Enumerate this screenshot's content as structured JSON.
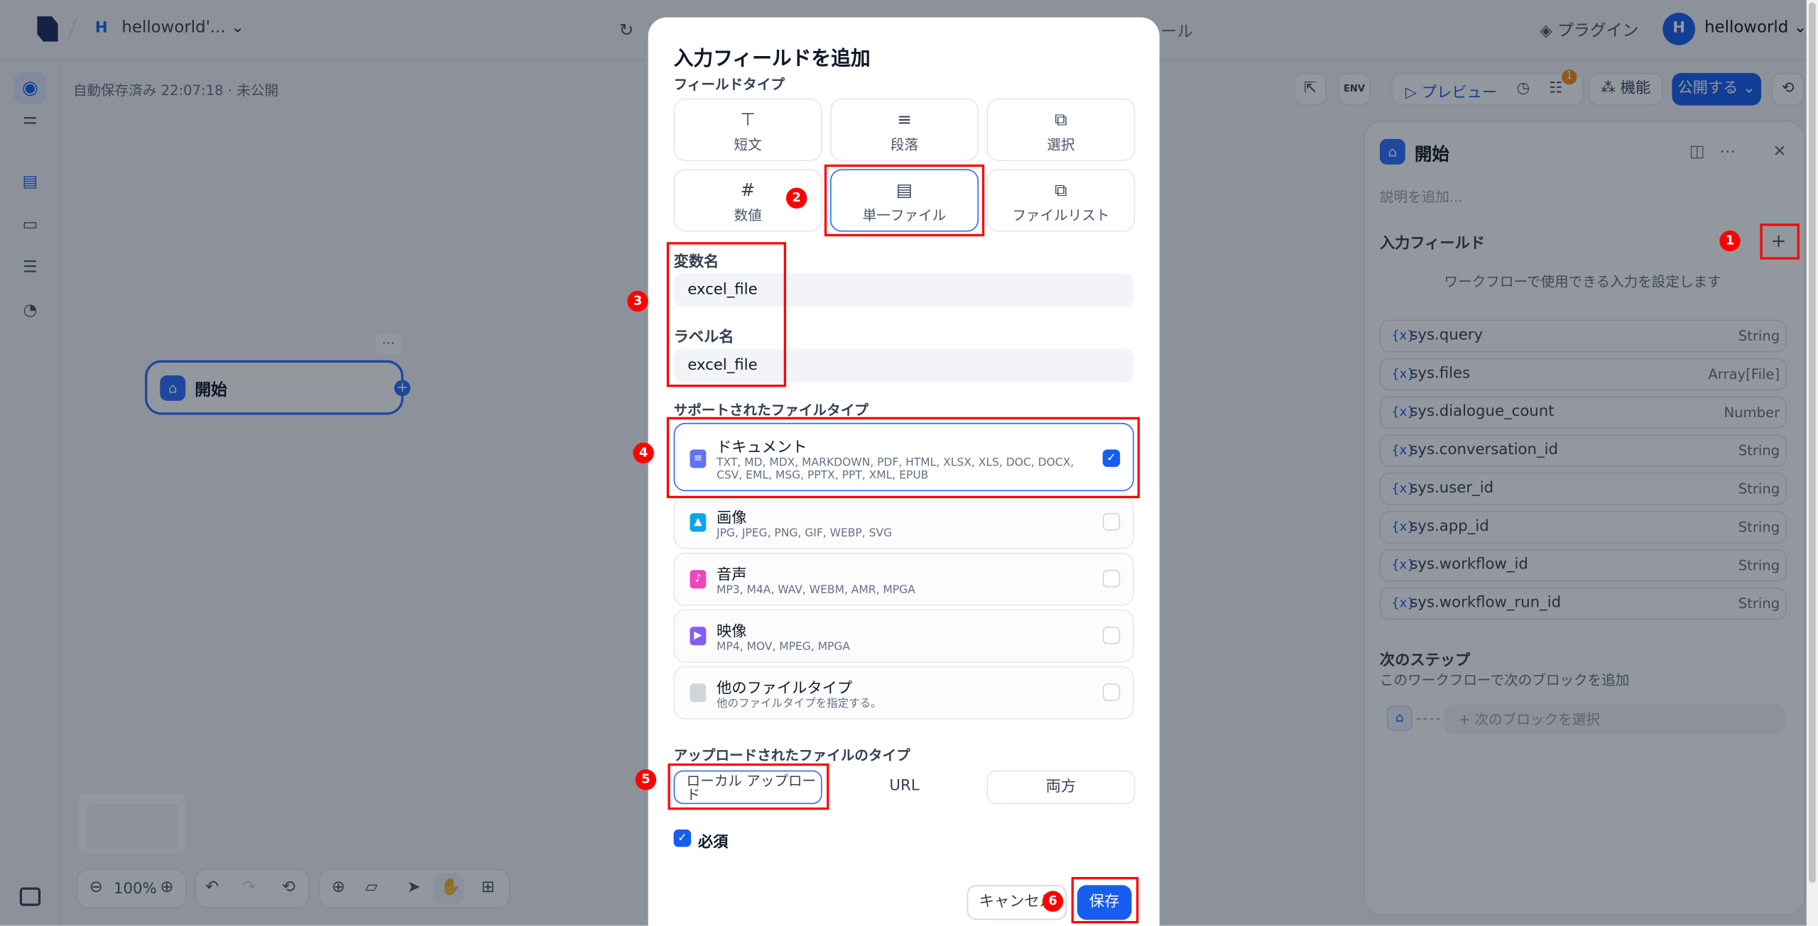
{
  "topbar": {
    "app_badge": "H",
    "app_name": "helloworld'...",
    "partial_title_tail": "ール",
    "plugins_label": "プラグイン",
    "user_initial": "H",
    "username": "helloworld"
  },
  "canvas": {
    "autosave_status": "自動保存済み 22:07:18 · 未公開",
    "node_title": "開始",
    "zoom_level": "100%"
  },
  "toolbar": {
    "preview_label": "プレビュー",
    "features_label": "機能",
    "publish_label": "公開する",
    "checklist_badge": "1",
    "env_label": "ENV"
  },
  "panel": {
    "title": "開始",
    "description_placeholder": "説明を追加...",
    "input_fields_heading": "入力フィールド",
    "input_fields_hint": "ワークフローで使用できる入力を設定します",
    "variables": [
      {
        "name": "sys.query",
        "type": "String"
      },
      {
        "name": "sys.files",
        "type": "Array[File]"
      },
      {
        "name": "sys.dialogue_count",
        "type": "Number"
      },
      {
        "name": "sys.conversation_id",
        "type": "String"
      },
      {
        "name": "sys.user_id",
        "type": "String"
      },
      {
        "name": "sys.app_id",
        "type": "String"
      },
      {
        "name": "sys.workflow_id",
        "type": "String"
      },
      {
        "name": "sys.workflow_run_id",
        "type": "String"
      }
    ],
    "var_prefix": "{x}",
    "next_step_heading": "次のステップ",
    "next_step_sub": "このワークフローで次のブロックを追加",
    "next_block_placeholder": "+ 次のブロックを選択"
  },
  "modal": {
    "title": "入力フィールドを追加",
    "field_type_label": "フィールドタイプ",
    "field_types": [
      {
        "label": "短文",
        "icon": "text-input-icon"
      },
      {
        "label": "段落",
        "icon": "paragraph-icon"
      },
      {
        "label": "選択",
        "icon": "select-icon"
      },
      {
        "label": "数値",
        "icon": "hash-icon"
      },
      {
        "label": "単一ファイル",
        "icon": "file-icon"
      },
      {
        "label": "ファイルリスト",
        "icon": "file-list-icon"
      }
    ],
    "selected_field_type": "単一ファイル",
    "variable_name_label": "変数名",
    "variable_name_value": "excel_file",
    "label_name_label": "ラベル名",
    "label_name_value": "excel_file",
    "supported_types_label": "サポートされたファイルタイプ",
    "file_types": [
      {
        "name": "ドキュメント",
        "exts": "TXT, MD, MDX, MARKDOWN, PDF, HTML, XLSX, XLS, DOC, DOCX, CSV, EML, MSG, PPTX, PPT, XML, EPUB",
        "checked": true,
        "color": "#6172f3"
      },
      {
        "name": "画像",
        "exts": "JPG, JPEG, PNG, GIF, WEBP, SVG",
        "checked": false,
        "color": "#0ba5ec"
      },
      {
        "name": "音声",
        "exts": "MP3, M4A, WAV, WEBM, AMR, MPGA",
        "checked": false,
        "color": "#ee46bc"
      },
      {
        "name": "映像",
        "exts": "MP4, MOV, MPEG, MPGA",
        "checked": false,
        "color": "#875bf7"
      },
      {
        "name": "他のファイルタイプ",
        "exts": "他のファイルタイプを指定する。",
        "checked": false,
        "color": "#d0d5dd"
      }
    ],
    "upload_types_label": "アップロードされたファイルのタイプ",
    "upload_types": [
      "ローカル アップロード",
      "URL",
      "両方"
    ],
    "selected_upload_type": "ローカル アップロード",
    "required_label": "必須",
    "required_checked": true,
    "cancel_label": "キャンセル",
    "save_label": "保存"
  },
  "annotations": [
    "1",
    "2",
    "3",
    "4",
    "5",
    "6"
  ],
  "colors": {
    "accent": "#155eef",
    "annotation": "#ff0000",
    "overlay": "rgba(16,24,40,0.45)"
  }
}
